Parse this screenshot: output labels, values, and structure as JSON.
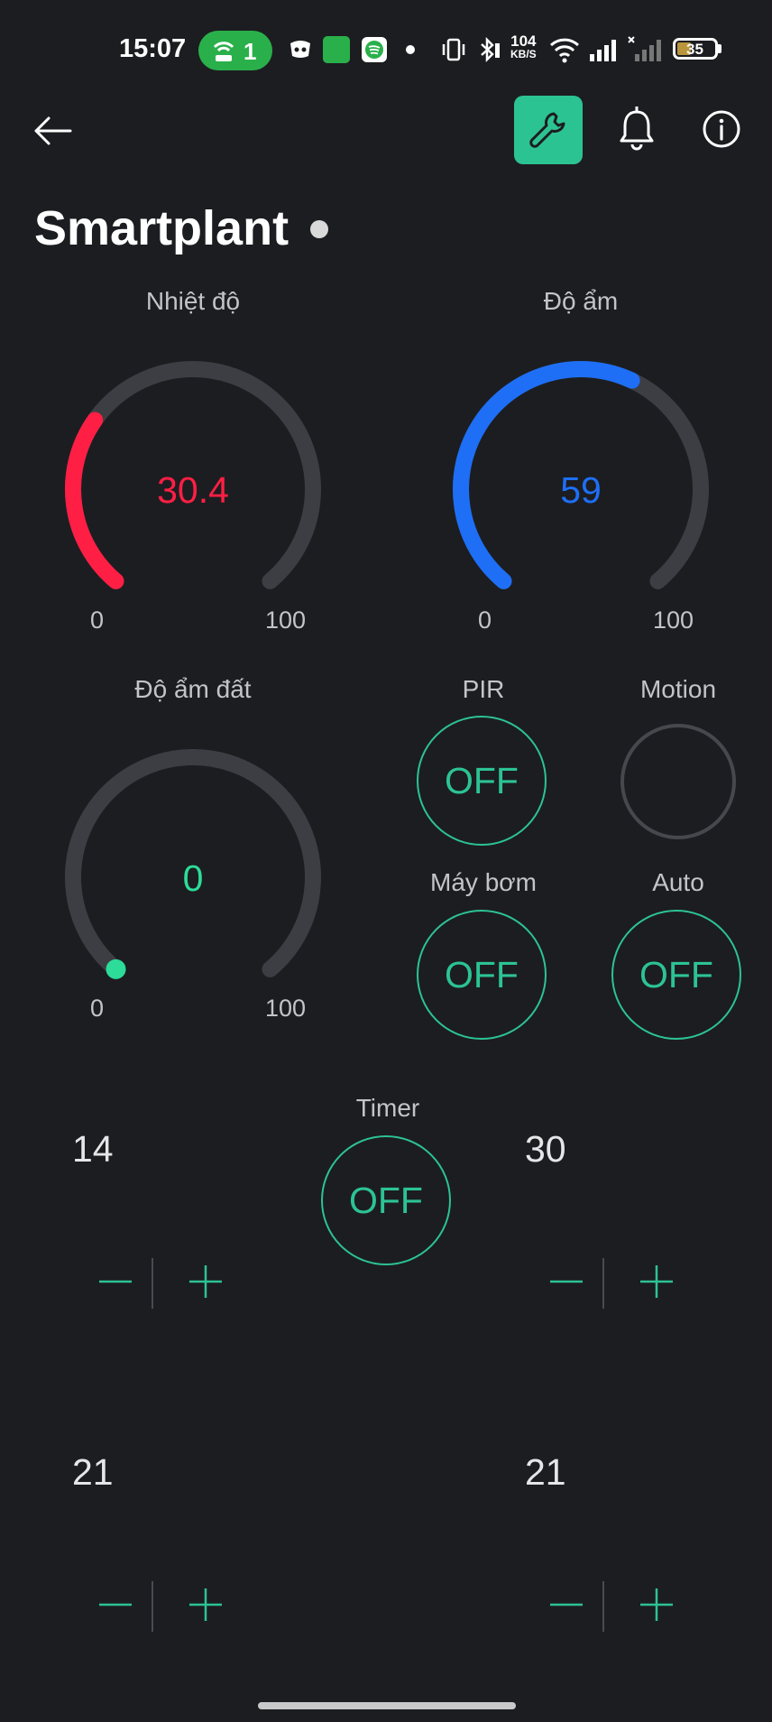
{
  "status_bar": {
    "time": "15:07",
    "hotspot_count": "1",
    "net_speed_value": "104",
    "net_speed_unit": "KB/S",
    "battery_level": "35"
  },
  "header": {
    "title": "Smartplant"
  },
  "gauges": [
    {
      "label": "Nhiệt độ",
      "value": "30.4",
      "min": "0",
      "max": "100",
      "fraction": 0.304,
      "color": "#ff1f44"
    },
    {
      "label": "Độ ẩm",
      "value": "59",
      "min": "0",
      "max": "100",
      "fraction": 0.59,
      "color": "#1e6ff6"
    },
    {
      "label": "Độ ẩm đất",
      "value": "0",
      "min": "0",
      "max": "100",
      "fraction": 0.0,
      "color": "#2cdc98"
    }
  ],
  "controls": {
    "pir": {
      "label": "PIR",
      "state": "OFF"
    },
    "motion": {
      "label": "Motion"
    },
    "pump": {
      "label": "Máy bơm",
      "state": "OFF"
    },
    "auto": {
      "label": "Auto",
      "state": "OFF"
    },
    "timer": {
      "label": "Timer",
      "state": "OFF"
    }
  },
  "steppers": [
    {
      "value": "14"
    },
    {
      "value": "30"
    },
    {
      "value": "21"
    },
    {
      "value": "21"
    }
  ],
  "colors": {
    "background": "#1c1d21",
    "accent": "#2cc392",
    "track": "#3d3e43"
  }
}
